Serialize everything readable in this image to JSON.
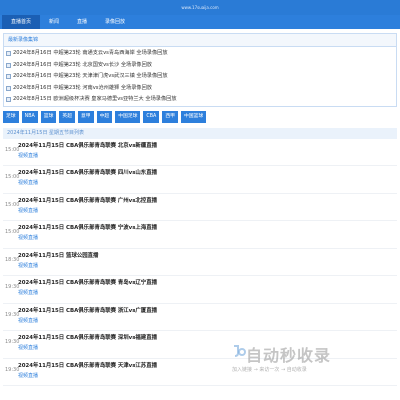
{
  "site": {
    "url": "www.17suaija.com"
  },
  "nav": {
    "tabs": [
      "直播首页",
      "新闻",
      "直播",
      "录像回放"
    ]
  },
  "recent": {
    "title": "最新录像集锦",
    "items": [
      "2024年8月16日 中超第23轮 南通支云vs青岛西海岸 全场录像回放",
      "2024年8月16日 中超第23轮 北京国安vs长沙 全场录像回放",
      "2024年8月16日 中超第23轮 天津津门虎vs武汉三镇 全场录像回放",
      "2024年8月16日 中超第23轮 河南vs沧州雄狮 全场录像回放",
      "2024年8月15日 欧洲超级杯决赛 皇家马德里vs亚特兰大 全场录像回放"
    ]
  },
  "tags": [
    "足球",
    "NBA",
    "篮球",
    "英超",
    "意甲",
    "中超",
    "中国足球",
    "CBA",
    "西甲",
    "中国篮球"
  ],
  "schedule": {
    "date": "2024年11月15日 星期五节目列表",
    "link_label": "视频直播",
    "rows": [
      {
        "time": "15:00",
        "title": "2024年11月15日 CBA俱乐部青岛联赛 北京vs新疆直播"
      },
      {
        "time": "15:00",
        "title": "2024年11月15日 CBA俱乐部青岛联赛 四川vs山东直播"
      },
      {
        "time": "15:00",
        "title": "2024年11月15日 CBA俱乐部青岛联赛 广州vs北控直播"
      },
      {
        "time": "15:00",
        "title": "2024年11月15日 CBA俱乐部青岛联赛 宁波vs上海直播"
      },
      {
        "time": "18:30",
        "title": "2024年11月15日 篮球公园直播"
      },
      {
        "time": "19:30",
        "title": "2024年11月15日 CBA俱乐部青岛联赛 青岛vs辽宁直播"
      },
      {
        "time": "19:30",
        "title": "2024年11月15日 CBA俱乐部青岛联赛 浙江vs广厦直播"
      },
      {
        "time": "19:30",
        "title": "2024年11月15日 CBA俱乐部青岛联赛 深圳vs福建直播"
      },
      {
        "time": "19:30",
        "title": "2024年11月15日 CBA俱乐部青岛联赛 天津vs江苏直播"
      }
    ]
  },
  "watermark": {
    "main": "自动秒收录",
    "sub": "加入链接 → 来访一次 → 自动收录"
  },
  "colors": {
    "accent": "#2d7fdc",
    "topbar": "#2a7bd6",
    "active_tab": "#1b5fb4"
  }
}
